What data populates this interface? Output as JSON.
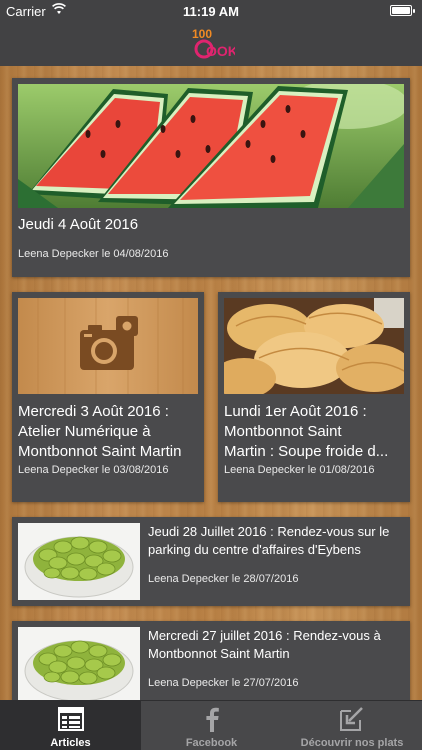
{
  "status_bar": {
    "carrier": "Carrier",
    "time": "11:19 AM",
    "battery_level": 1.0
  },
  "nav": {
    "logo_text": "100 COOK"
  },
  "articles": [
    {
      "title": "Jeudi 4 Août 2016",
      "byline": "Leena Depecker le 04/08/2016",
      "image": "watermelon-slices"
    },
    {
      "title_lines": [
        "Mercredi 3 Août 2016 :",
        "Atelier Numérique à",
        "Montbonnot Saint Martin"
      ],
      "byline": "Leena Depecker le 03/08/2016",
      "image": "camera-placeholder-icon"
    },
    {
      "title_lines": [
        "Lundi 1er Août 2016 :",
        "Montbonnot Saint",
        "Martin : Soupe froide d..."
      ],
      "byline": "Leena Depecker le 01/08/2016",
      "image": "empanadas"
    },
    {
      "title": "Jeudi 28 Juillet 2016 : Rendez-vous sur le parking du centre d'affaires d'Eybens",
      "byline": "Leena Depecker le 28/07/2016",
      "image": "fava-beans-bowl"
    },
    {
      "title": "Mercredi 27 juillet 2016 : Rendez-vous à Montbonnot Saint Martin",
      "byline": "Leena Depecker le 27/07/2016",
      "image": "fava-beans-bowl"
    }
  ],
  "tab_bar": {
    "tabs": [
      {
        "label": "Articles",
        "icon": "articles-icon",
        "active": true
      },
      {
        "label": "Facebook",
        "icon": "facebook-icon",
        "active": false
      },
      {
        "label": "Découvrir nos plats",
        "icon": "discover-icon",
        "active": false
      }
    ]
  },
  "colors": {
    "bar_background": "#424244",
    "card_background": "#4a4a4c",
    "tab_active_background": "#2e2e30",
    "logo_pink": "#e0246f",
    "logo_orange": "#f08a24"
  }
}
